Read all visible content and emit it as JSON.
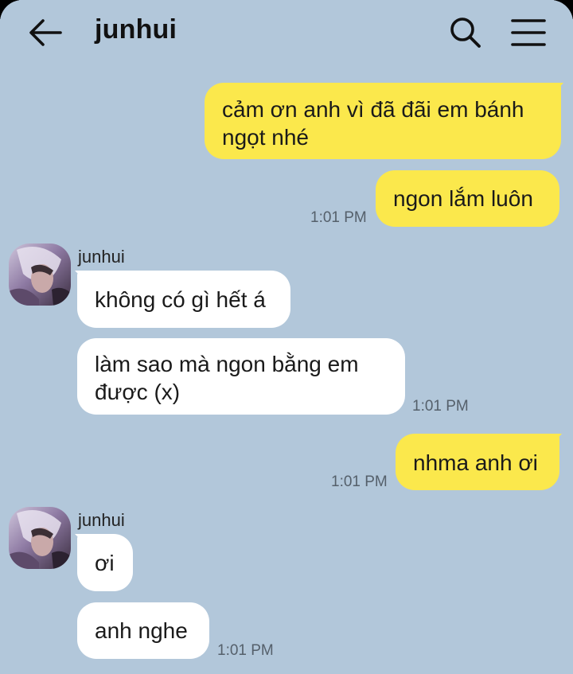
{
  "header": {
    "title": "junhui",
    "back_icon": "arrow-left-icon",
    "search_icon": "search-icon",
    "menu_icon": "hamburger-menu-icon"
  },
  "colors": {
    "background": "#b2c7da",
    "my_bubble": "#fbe84c",
    "their_bubble": "#ffffff",
    "time_text": "#55606b"
  },
  "messages": [
    {
      "from": "me",
      "text": "cảm ơn anh vì đã đãi em bánh ngọt nhé"
    },
    {
      "from": "me",
      "text": "ngon lắm luôn",
      "time": "1:01 PM"
    },
    {
      "from": "junhui",
      "sender": "junhui",
      "text": "không có gì hết á"
    },
    {
      "from": "junhui",
      "text": "làm sao mà ngon bằng em được (x)",
      "time": "1:01 PM"
    },
    {
      "from": "me",
      "text": "nhma anh ơi",
      "time": "1:01 PM"
    },
    {
      "from": "junhui",
      "sender": "junhui",
      "text": "ơi"
    },
    {
      "from": "junhui",
      "text": "anh nghe",
      "time": "1:01 PM"
    }
  ]
}
